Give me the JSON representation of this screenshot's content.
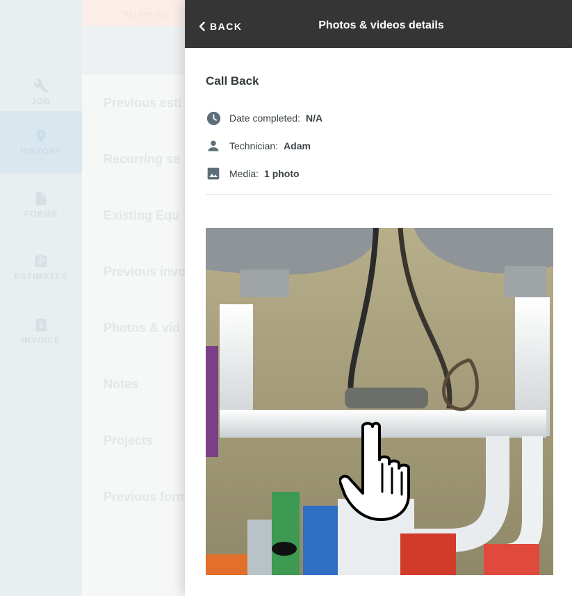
{
  "background": {
    "banner_text": "You are curr",
    "sidebar": {
      "items": [
        {
          "label": "JOB",
          "icon": "wrench-icon"
        },
        {
          "label": "HISTORY",
          "icon": "location-pin-icon"
        },
        {
          "label": "FORMS",
          "icon": "form-document-icon"
        },
        {
          "label": "ESTIMATES",
          "icon": "clipboard-icon"
        },
        {
          "label": "INVOICE",
          "icon": "invoice-dollar-icon"
        }
      ]
    },
    "list_items": [
      "Previous esti",
      "Recurring se",
      "Existing Equ",
      "Previous invo",
      "Photos & vid",
      "Notes",
      "Projects",
      "Previous form"
    ]
  },
  "drawer": {
    "back_label": "BACK",
    "title": "Photos & videos details",
    "section_title": "Call Back",
    "meta": {
      "date_label": "Date completed:",
      "date_value": "N/A",
      "technician_label": "Technician:",
      "technician_value": "Adam",
      "media_label": "Media:",
      "media_value": "1 photo"
    },
    "photo_alt": "Under-sink plumbing photo"
  },
  "colors": {
    "header_bg": "#353535",
    "icon_color": "#5c6e78",
    "banner_bg": "#fbeee8"
  }
}
